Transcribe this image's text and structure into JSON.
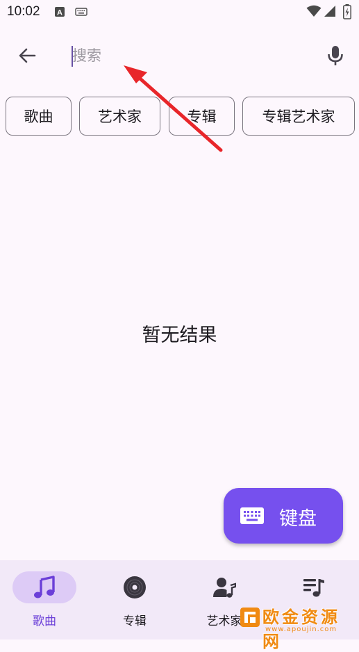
{
  "status_bar": {
    "time": "10:02",
    "icons": [
      "notification-a-icon",
      "keyboard-icon",
      "wifi-icon",
      "signal-icon",
      "battery-charging-icon"
    ]
  },
  "search": {
    "placeholder": "搜索",
    "value": "",
    "back_icon": "arrow-back-icon",
    "mic_icon": "mic-icon"
  },
  "chips": [
    {
      "label": "歌曲"
    },
    {
      "label": "艺术家"
    },
    {
      "label": "专辑"
    },
    {
      "label": "专辑艺术家"
    }
  ],
  "empty_state": {
    "text": "暂无结果"
  },
  "fab": {
    "label": "键盘",
    "icon": "keyboard-icon"
  },
  "bottom_nav": {
    "items": [
      {
        "label": "歌曲",
        "icon": "music-note-icon",
        "selected": true
      },
      {
        "label": "专辑",
        "icon": "album-icon",
        "selected": false
      },
      {
        "label": "艺术家",
        "icon": "artist-icon",
        "selected": false
      },
      {
        "label": "",
        "icon": "playlist-icon",
        "selected": false
      }
    ]
  },
  "colors": {
    "background": "#fdf7fd",
    "accent": "#7650ee",
    "nav_background": "#f2e9f8",
    "selected_pill": "#ddcbf6",
    "annotation_arrow": "#e8262a"
  },
  "watermark": {
    "text": "欧金资源网",
    "url": "www.apoujin.com"
  }
}
